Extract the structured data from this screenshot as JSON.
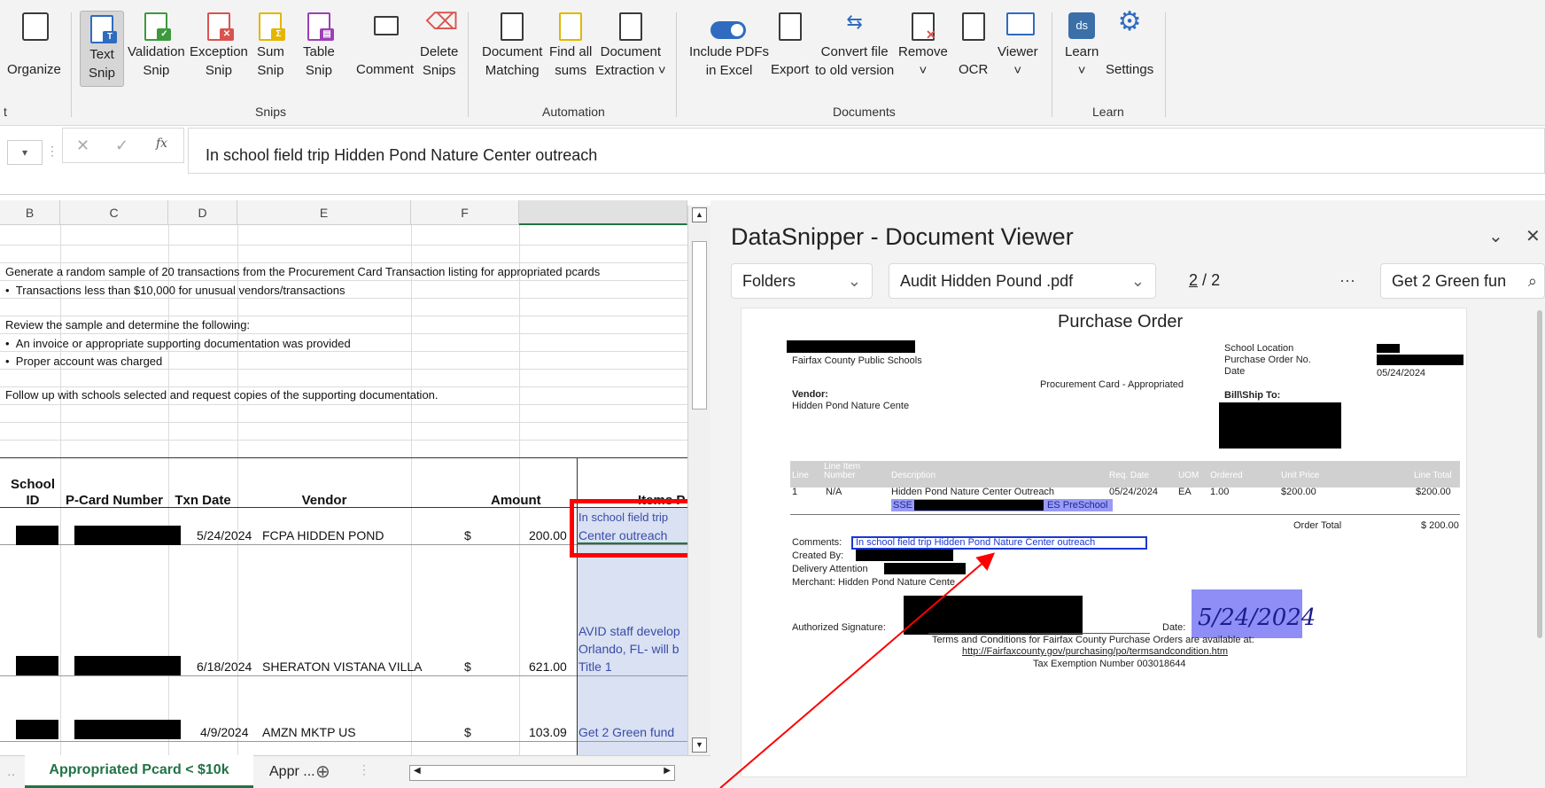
{
  "ribbon": {
    "buttons": [
      {
        "label1": "Organize",
        "label2": ""
      },
      {
        "label1": "Text",
        "label2": "Snip"
      },
      {
        "label1": "Validation",
        "label2": "Snip"
      },
      {
        "label1": "Exception",
        "label2": "Snip"
      },
      {
        "label1": "Sum",
        "label2": "Snip"
      },
      {
        "label1": "Table",
        "label2": "Snip"
      },
      {
        "label1": "Comment",
        "label2": ""
      },
      {
        "label1": "Delete",
        "label2": "Snips"
      },
      {
        "label1": "Document",
        "label2": "Matching"
      },
      {
        "label1": "Find all",
        "label2": "sums"
      },
      {
        "label1": "Document",
        "label2": "Extraction ˅"
      },
      {
        "label1": "Include PDFs",
        "label2": "in Excel"
      },
      {
        "label1": "Export",
        "label2": ""
      },
      {
        "label1": "Convert file",
        "label2": "to old version"
      },
      {
        "label1": "Remove",
        "label2": "˅"
      },
      {
        "label1": "OCR",
        "label2": ""
      },
      {
        "label1": "Viewer",
        "label2": "˅"
      },
      {
        "label1": "Learn",
        "label2": "˅"
      },
      {
        "label1": "Settings",
        "label2": ""
      }
    ],
    "groups": [
      "t",
      "Snips",
      "Automation",
      "Documents",
      "Learn"
    ]
  },
  "formula_bar": {
    "fx": "fx",
    "content": "In school field trip Hidden Pond Nature Center outreach"
  },
  "sheet": {
    "columns": [
      "B",
      "C",
      "D",
      "E",
      "F"
    ],
    "instructions": [
      "Generate a random sample of 20 transactions from the Procurement Card Transaction listing for appropriated pcards",
      "Transactions less than $10,000 for unusual vendors/transactions",
      "Review the sample and determine the following:",
      "An invoice or appropriate supporting documentation was provided",
      "Proper account was charged",
      "Follow up with schools selected and request copies of the supporting documentation."
    ],
    "headers": {
      "school": "School",
      "id": "ID",
      "pcard": "P-Card Number",
      "txn": "Txn Date",
      "vendor": "Vendor",
      "amount": "Amount",
      "items": "Items P"
    },
    "rows": [
      {
        "date": "5/24/2024",
        "vendor": "FCPA HIDDEN POND",
        "cur": "$",
        "amount": "200.00",
        "item1": "In school field trip",
        "item2": "Center outreach",
        "item3": ""
      },
      {
        "date": "6/18/2024",
        "vendor": "SHERATON VISTANA VILLA",
        "cur": "$",
        "amount": "621.00",
        "item1": "AVID staff develop",
        "item2": "Orlando, FL- will b",
        "item3": "Title 1"
      },
      {
        "date": "4/9/2024",
        "vendor": "AMZN MKTP US",
        "cur": "$",
        "amount": "103.09",
        "item1": "Get 2 Green fund",
        "item2": "",
        "item3": ""
      }
    ],
    "tabs": {
      "active": "Appropriated Pcard < $10k",
      "next": "Appr ...",
      "add": "⊕"
    }
  },
  "viewer": {
    "title": "DataSnipper - Document Viewer",
    "folders": "Folders",
    "file": "Audit Hidden Pound .pdf",
    "page_current": "2",
    "page_sep": "/",
    "page_total": "2",
    "more": "···",
    "search": "Get 2 Green fun"
  },
  "pdf": {
    "title": "Purchase Order",
    "org": "Fairfax County Public Schools",
    "school_location": "School Location",
    "po_no": "Purchase Order No.",
    "date_label": "Date",
    "date_value": "05/24/2024",
    "proc": "Procurement Card - Appropriated",
    "vendor_label": "Vendor:",
    "vendor_name": "Hidden Pond Nature Cente",
    "billship": "Bill\\Ship To:",
    "line_headers": [
      "Line",
      "Line Item Number",
      "Description",
      "Req. Date",
      "UOM",
      "Ordered",
      "Unit Price",
      "Line Total"
    ],
    "line": {
      "no": "1",
      "item": "N/A",
      "desc": "Hidden Pond Nature Center Outreach",
      "date": "05/24/2024",
      "uom": "EA",
      "qty": "1.00",
      "unit": "$200.00",
      "total": "$200.00",
      "sse": "SSE",
      "es": "ES PreSchool"
    },
    "order_total_label": "Order Total",
    "order_total": "$ 200.00",
    "comments_label": "Comments:",
    "comments": "In school field trip Hidden Pond Nature Center outreach",
    "created_by": "Created By:",
    "delivery": "Delivery Attention",
    "merchant": "Merchant:  Hidden Pond Nature Cente",
    "auth_sig": "Authorized Signature:",
    "sig_date_label": "Date:",
    "sig_date": "5/24/2024",
    "terms": "Terms and Conditions for Fairfax County Purchase Orders are available at:",
    "url": "http://Fairfaxcounty.gov/purchasing/po/termsandcondition.htm",
    "tax": "Tax Exemption Number 003018644"
  },
  "colors": {
    "accent_green": "#217346",
    "highlight_red": "#ff0000",
    "snip_blue": "#1a37d6",
    "items_fill": "#d9e1f2"
  }
}
